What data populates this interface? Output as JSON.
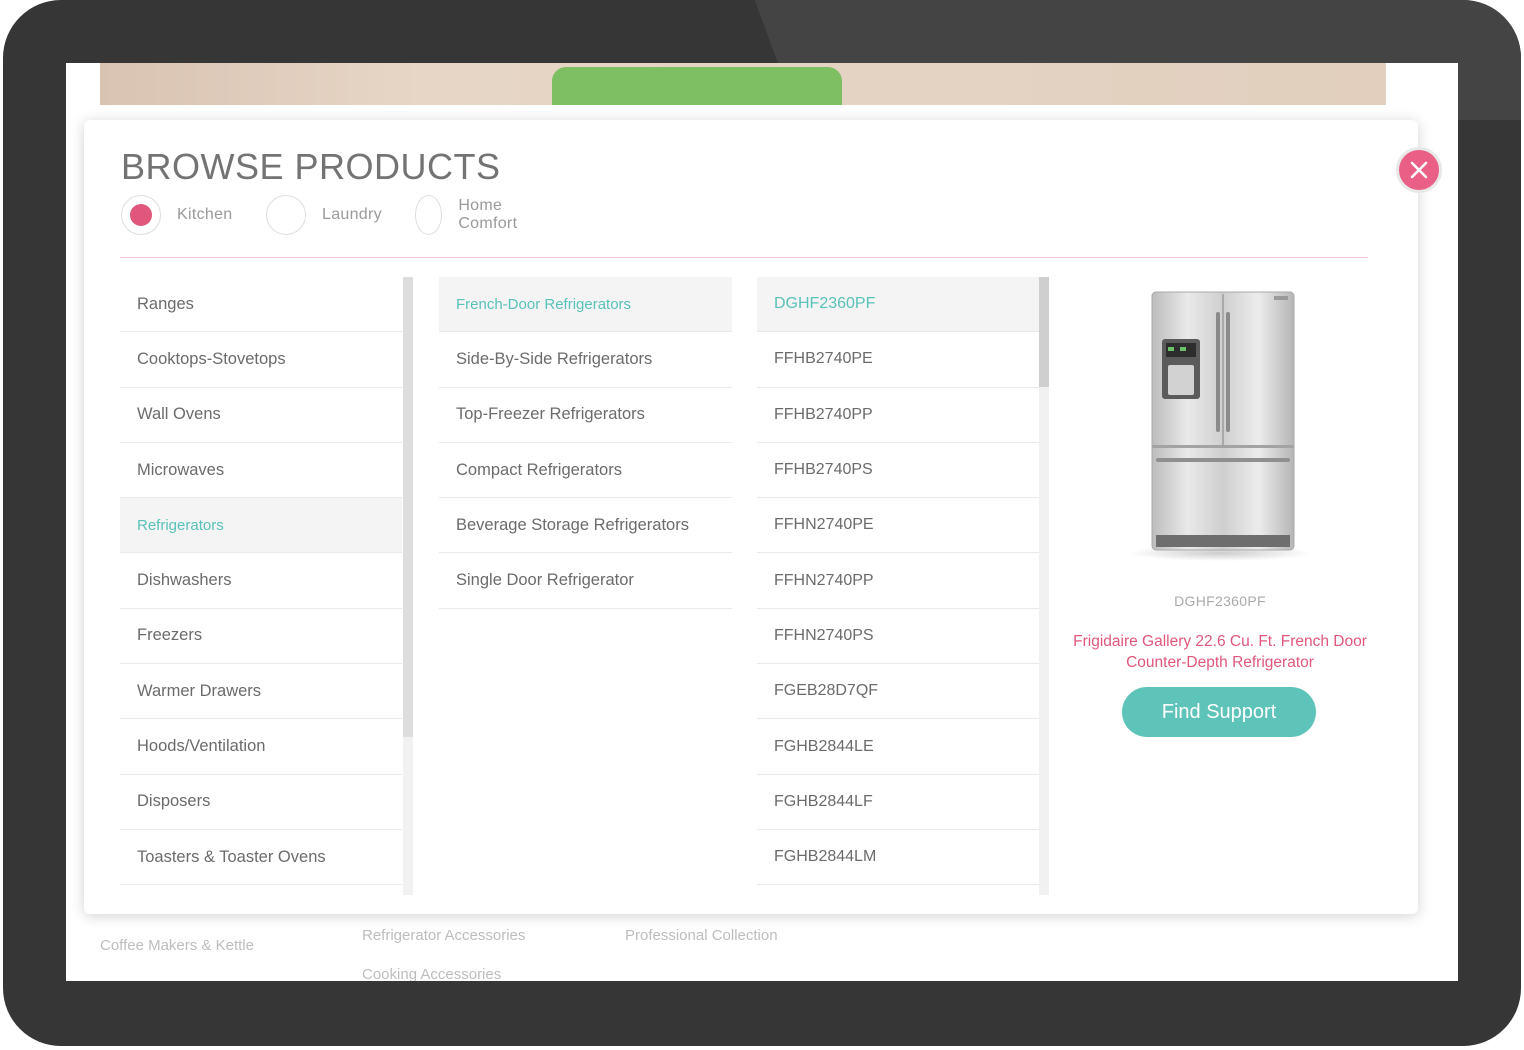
{
  "background_page": {
    "links": [
      "Coffee Makers & Kettle",
      "Refrigerator Accessories",
      "Professional Collection",
      "Cooking Accessories"
    ]
  },
  "modal": {
    "title": "BROWSE PRODUCTS",
    "close_icon": "close-icon",
    "tabs": [
      {
        "label": "Kitchen",
        "selected": true
      },
      {
        "label": "Laundry",
        "selected": false
      },
      {
        "label": "Home Comfort",
        "selected": false
      }
    ],
    "categories": [
      "Ranges",
      "Cooktops-Stovetops",
      "Wall Ovens",
      "Microwaves",
      "Refrigerators",
      "Dishwashers",
      "Freezers",
      "Warmer Drawers",
      "Hoods/Ventilation",
      "Disposers",
      "Toasters & Toaster Ovens"
    ],
    "selected_category": "Refrigerators",
    "subcategories": [
      "French-Door Refrigerators",
      "Side-By-Side Refrigerators",
      "Top-Freezer Refrigerators",
      "Compact Refrigerators",
      "Beverage Storage Refrigerators",
      "Single Door Refrigerator"
    ],
    "selected_subcategory": "French-Door Refrigerators",
    "models": [
      "DGHF2360PF",
      "FFHB2740PE",
      "FFHB2740PP",
      "FFHB2740PS",
      "FFHN2740PE",
      "FFHN2740PP",
      "FFHN2740PS",
      "FGEB28D7QF",
      "FGHB2844LE",
      "FGHB2844LF",
      "FGHB2844LM"
    ],
    "selected_model": "DGHF2360PF",
    "product": {
      "model": "DGHF2360PF",
      "name": "Frigidaire Gallery 22.6 Cu. Ft. French Door Counter-Depth Refrigerator",
      "button_label": "Find Support",
      "image": "refrigerator-image"
    }
  },
  "colors": {
    "accent_pink": "#e0577b",
    "accent_teal": "#5ec3b8",
    "frame": "#363636"
  }
}
